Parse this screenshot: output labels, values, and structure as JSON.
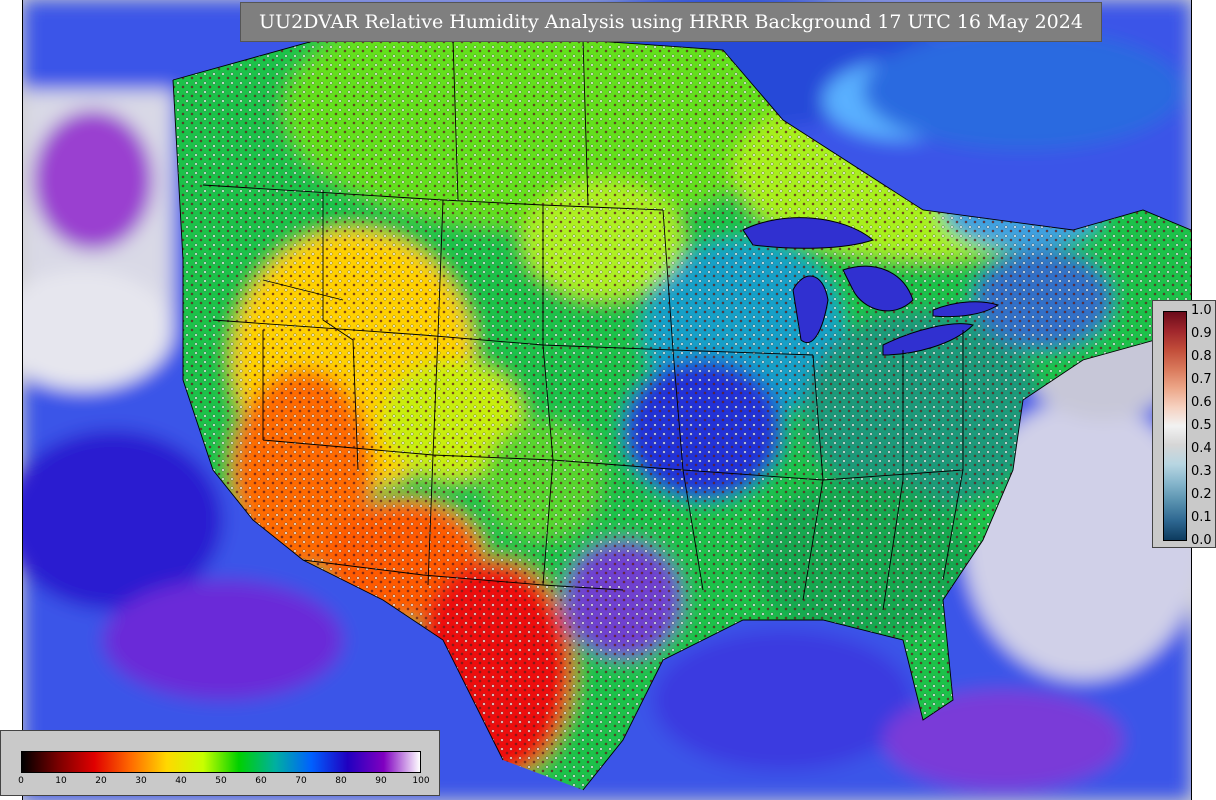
{
  "title": "UU2DVAR Relative Humidity Analysis using HRRR Background 17 UTC 16 May 2024",
  "map": {
    "variable": "Relative Humidity",
    "field_colormap": "jet-like: red (dry) to green to blue/purple (moist), white/grey near saturation",
    "background_land_ocean": "#cfcfcf",
    "features": [
      "state-borders",
      "coastlines",
      "great-lakes",
      "observation-stations"
    ]
  },
  "rh_legend": {
    "ticks": [
      "1.0",
      "0.9",
      "0.8",
      "0.7",
      "0.6",
      "0.5",
      "0.4",
      "0.3",
      "0.2",
      "0.1",
      "0.0"
    ],
    "colors": [
      "#6b0b1a",
      "#a0262c",
      "#c24e3a",
      "#d9795b",
      "#eca688",
      "#f6d1c0",
      "#f2f2f2",
      "#d6d6d6",
      "#b8d6e2",
      "#86b6cc",
      "#5790ae",
      "#2d6690",
      "#0d3b5e"
    ]
  },
  "obs_legend": {
    "ticks": [
      "0",
      "10",
      "20",
      "30",
      "40",
      "50",
      "60",
      "70",
      "80",
      "90",
      "100"
    ],
    "colors": [
      "#000000",
      "#7a0000",
      "#e00000",
      "#ff6a00",
      "#ffd800",
      "#c8ff00",
      "#00d000",
      "#00b0a0",
      "#0060ff",
      "#2000c0",
      "#8000c0",
      "#ffffff"
    ]
  }
}
